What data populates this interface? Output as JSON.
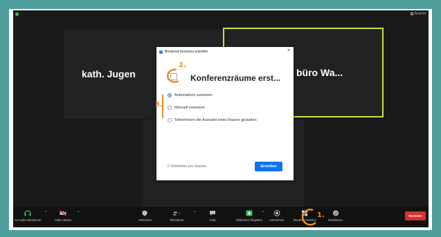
{
  "window": {
    "view_label": "Ansicht"
  },
  "participants": [
    {
      "name": "kath. Jugen"
    },
    {
      "name": "büro Wa..."
    }
  ],
  "dialog": {
    "title": "Breakout-Sessions erstellen",
    "close": "×",
    "heading": "Konferenzräume erst...",
    "room_count": "1",
    "options": [
      {
        "label": "Automatisch zuweisen",
        "selected": true
      },
      {
        "label": "Manuell zuweisen",
        "selected": false
      },
      {
        "label": "Teilnehmern die Auswahl eines Raums gestatten",
        "selected": false
      }
    ],
    "participants_per_session": "0 Teilnehmer pro Session",
    "create_label": "Erstellen"
  },
  "toolbar": {
    "audio": "An Audio teilnehmen",
    "video": "Video starten",
    "security": "Sicherheit",
    "participants": "Teilnehmer",
    "participant_count": "1",
    "chat": "Chat",
    "share": "Bildschirm freigeben",
    "record": "Aufnehmen",
    "breakout": "Breakout Session",
    "reactions": "Reaktionen",
    "end": "Beenden"
  },
  "annotations": {
    "step1": "1.",
    "step2": "2.",
    "step3": "3."
  },
  "colors": {
    "background": "#4f9e9c",
    "active_speaker": "#c9e04c",
    "accent": "#0e72ed",
    "end": "#d9302c",
    "annotation": "#f08a24",
    "share_icon": "#35c45a"
  }
}
